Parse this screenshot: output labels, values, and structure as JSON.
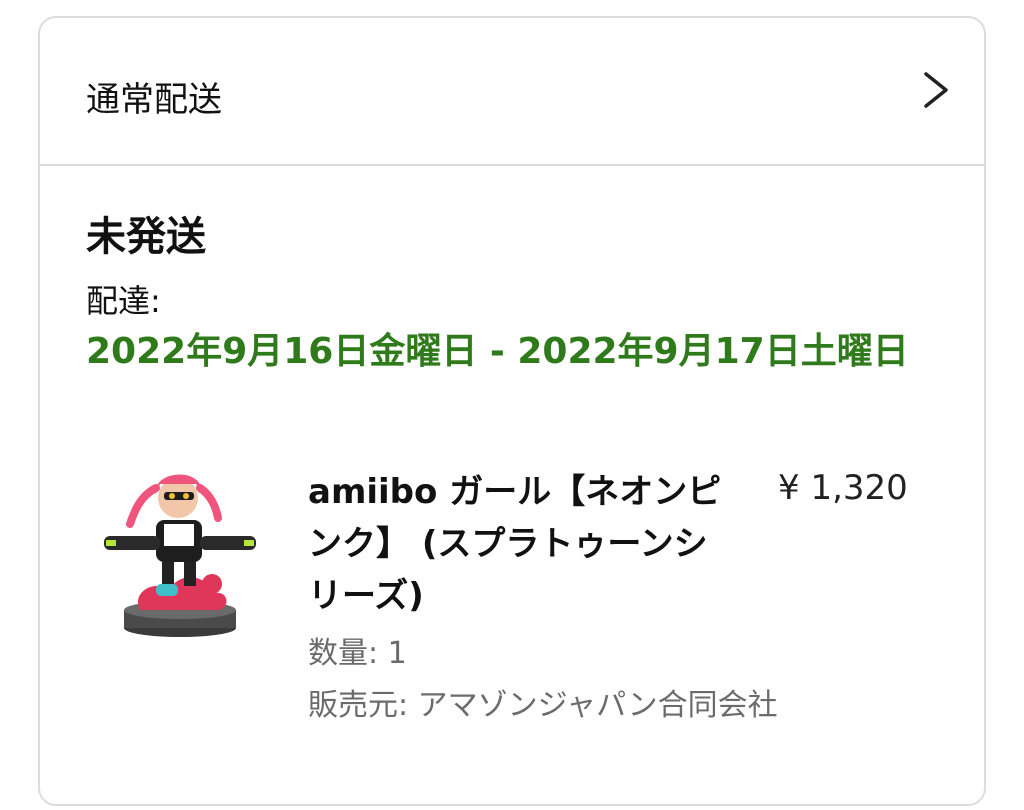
{
  "shipping": {
    "method_label": "通常配送",
    "chevron_icon": "chevron-right-icon"
  },
  "order": {
    "status": "未発送",
    "delivery_label": "配達:",
    "delivery_range": "2022年9月16日金曜日 - 2022年9月17日土曜日",
    "delivery_color": "#2f7a1b"
  },
  "item": {
    "image_icon": "amiibo-figure-image",
    "title": "amiibo ガール【ネオンピンク】 (スプラトゥーンシリーズ)",
    "price": "¥ 1,320",
    "quantity": "数量: 1",
    "seller": "販売元: アマゾンジャパン合同会社"
  }
}
